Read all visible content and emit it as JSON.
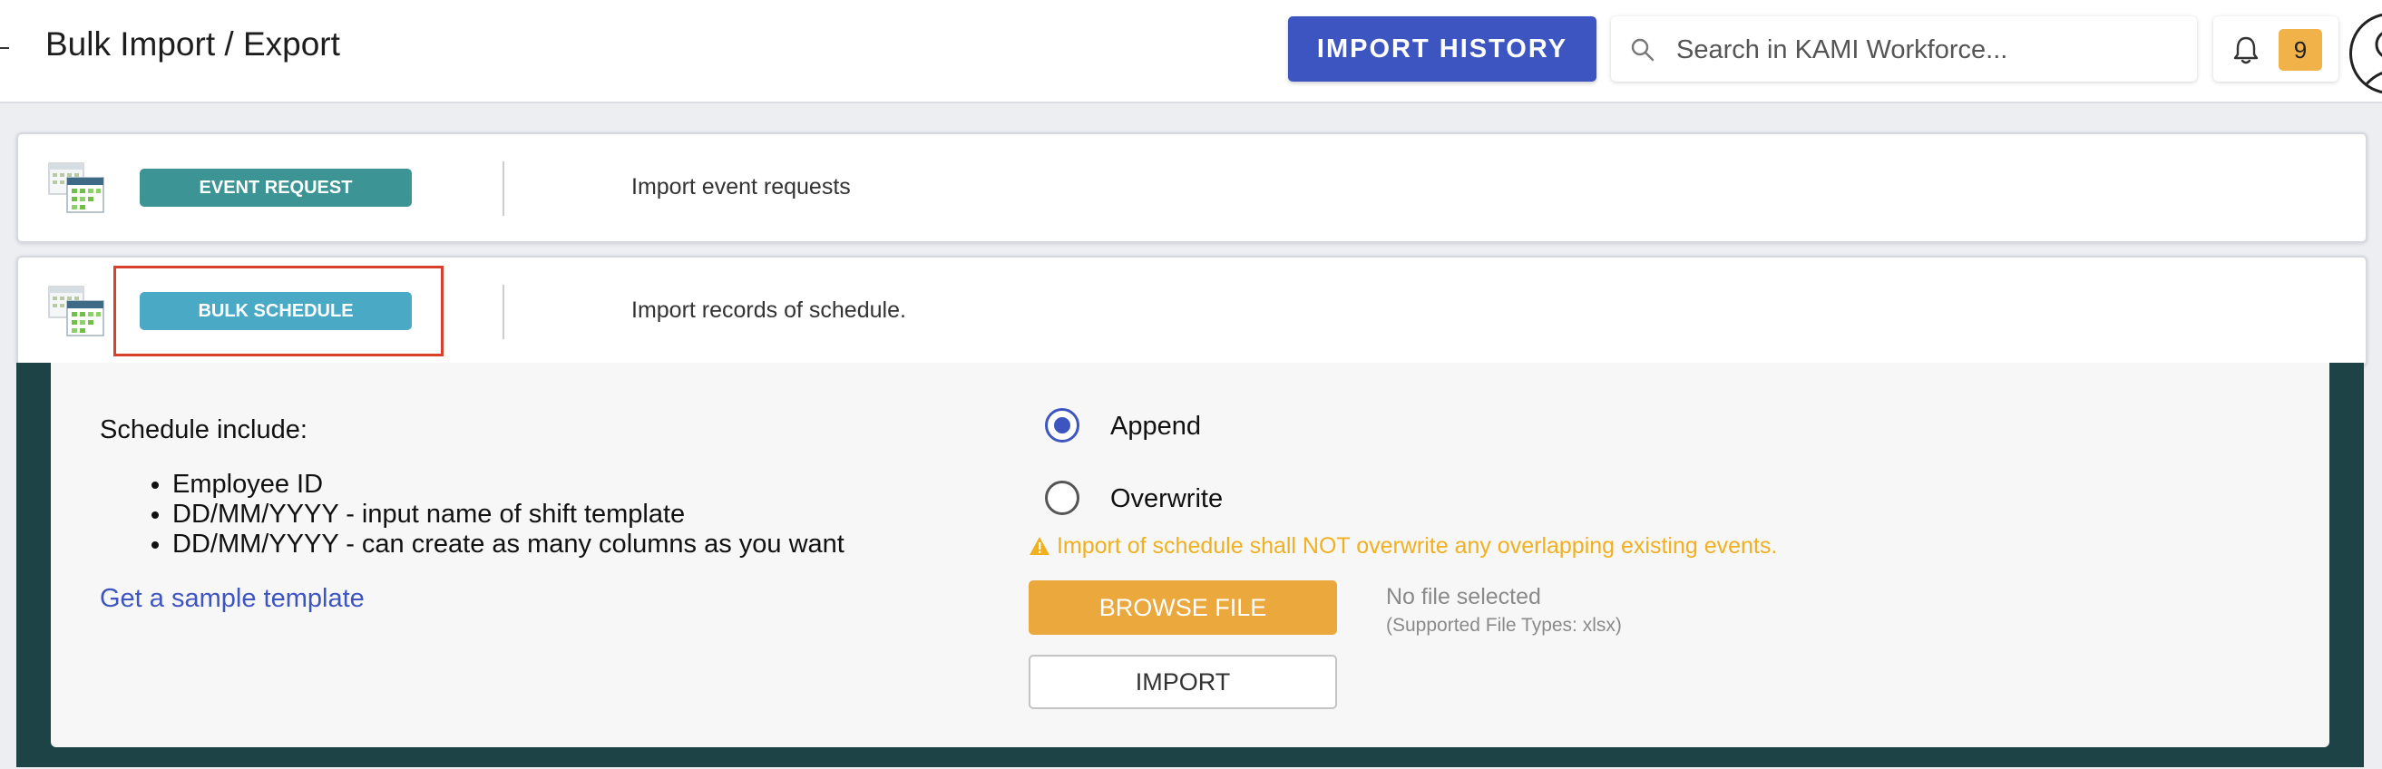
{
  "header": {
    "title": "Bulk Import / Export",
    "import_history_label": "IMPORT HISTORY",
    "search_placeholder": "Search in KAMI Workforce...",
    "notification_count": "9"
  },
  "cards": [
    {
      "label": "EVENT REQUEST",
      "description": "Import event requests",
      "color": "#3d9495"
    },
    {
      "label": "BULK SCHEDULE",
      "description": "Import records of schedule.",
      "color": "#4aaac6"
    }
  ],
  "panel": {
    "title": "Schedule include:",
    "items": [
      "Employee ID",
      "DD/MM/YYYY - input name of shift template",
      "DD/MM/YYYY - can create as many columns as you want"
    ],
    "sample_link": "Get a sample template",
    "mode_options": [
      {
        "label": "Append",
        "selected": true
      },
      {
        "label": "Overwrite",
        "selected": false
      }
    ],
    "warning": "Import of schedule shall NOT overwrite any overlapping existing events.",
    "browse_label": "BROWSE FILE",
    "file_status": "No file selected",
    "file_types": "(Supported File Types: xlsx)",
    "import_label": "IMPORT"
  },
  "colors": {
    "primary": "#3d55c1",
    "warning": "#f0b020",
    "browse": "#eba83c",
    "highlight": "#d9402b"
  }
}
